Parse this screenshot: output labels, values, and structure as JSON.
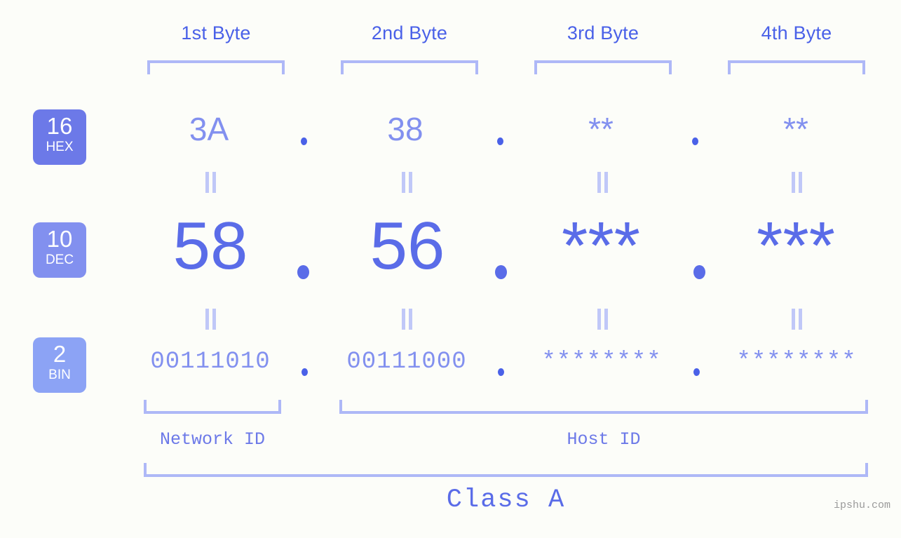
{
  "meta": {
    "background_color": "#fcfdf9",
    "accent_dark": "#4a61e8",
    "accent_mid": "#5a6ce8",
    "accent_light": "#8290ef",
    "bracket_color": "#aeb8f7",
    "connector_color": "#c0c8f8",
    "watermark_color": "#9a9a9a"
  },
  "header": {
    "byte_labels": [
      {
        "text": "1st Byte"
      },
      {
        "text": "2nd Byte"
      },
      {
        "text": "3rd Byte"
      },
      {
        "text": "4th Byte"
      }
    ]
  },
  "bases": [
    {
      "id": "hex",
      "number": "16",
      "name": "HEX",
      "color": "#6c79e8"
    },
    {
      "id": "dec",
      "number": "10",
      "name": "DEC",
      "color": "#8290ef"
    },
    {
      "id": "bin",
      "number": "2",
      "name": "BIN",
      "color": "#8ca3f5"
    }
  ],
  "rows": {
    "hex": {
      "values": [
        "3A",
        "38",
        "**",
        "**"
      ],
      "separator": "."
    },
    "dec": {
      "values": [
        "58",
        "56",
        "***",
        "***"
      ],
      "separator": "."
    },
    "bin": {
      "values": [
        "00111010",
        "00111000",
        "********",
        "********"
      ],
      "separator": "."
    }
  },
  "connectors": {
    "glyph": "equals-vertical",
    "rows": [
      "hex-to-dec",
      "dec-to-bin"
    ]
  },
  "footer": {
    "network_id_label": "Network ID",
    "host_id_label": "Host ID",
    "class_label": "Class A",
    "watermark": "ipshu.com"
  }
}
